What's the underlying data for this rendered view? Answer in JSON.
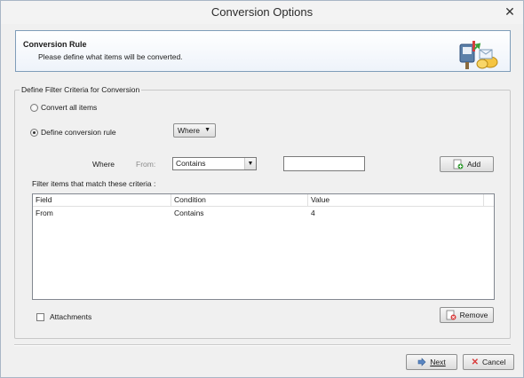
{
  "window": {
    "title": "Conversion Options",
    "close_glyph": "✕"
  },
  "header": {
    "title": "Conversion Rule",
    "subtitle": "Please define what items will be converted.",
    "icon": "mailbox-convert-icon"
  },
  "group": {
    "legend": "Define Filter Criteria for Conversion",
    "radio_all": {
      "label": "Convert all items",
      "checked": false
    },
    "radio_rule": {
      "label": "Define conversion rule",
      "checked": true
    },
    "rule_dropdown": {
      "value": "Where"
    }
  },
  "criteria": {
    "where_label": "Where",
    "field_label": "From:",
    "condition_select": {
      "value": "Contains"
    },
    "value_input": {
      "value": "",
      "placeholder": ""
    },
    "add_button": "Add"
  },
  "filter_table": {
    "caption": "Filter items that match these criteria :",
    "columns": [
      "Field",
      "Condition",
      "Value"
    ],
    "rows": [
      {
        "field": "From",
        "condition": "Contains",
        "value": "4"
      }
    ]
  },
  "attachments": {
    "label": "Attachments",
    "checked": false
  },
  "remove_button": "Remove",
  "footer": {
    "next_button": "Next",
    "cancel_button": "Cancel"
  },
  "colors": {
    "accent_green": "#3aa13a",
    "accent_red": "#d83b3b",
    "header_border": "#7f9db9"
  }
}
